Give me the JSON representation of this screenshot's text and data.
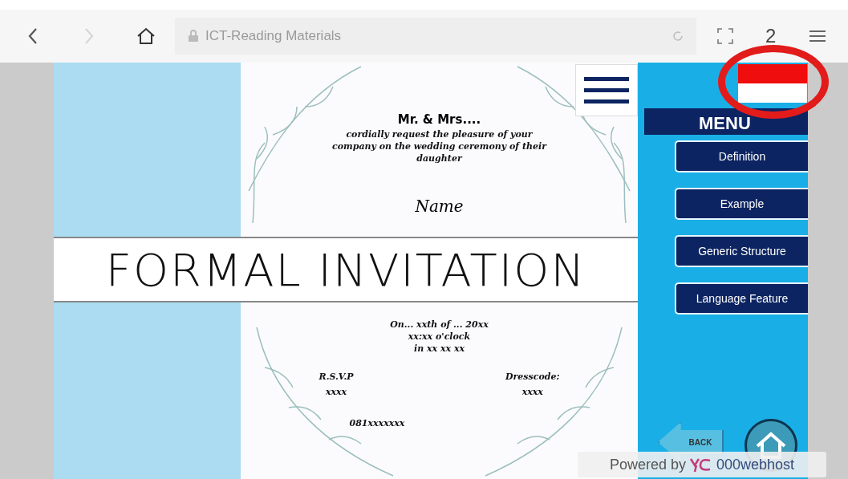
{
  "browser": {
    "back_disabled": false,
    "forward_disabled": true,
    "address": "ICT-Reading Materials",
    "tab_count": "2"
  },
  "invitation": {
    "hosts": "Mr. & Mrs....",
    "request": "cordially request the pleasure of your company on the wedding ceremony of their daughter",
    "name": "Name",
    "title": "FORMAL INVITATION",
    "date": "On... xxth of ... 20xx",
    "time": "xx:xx o'clock",
    "place": "in xx xx xx",
    "rsvp_label": "R.S.V.P",
    "rsvp_value": "xxxx",
    "dresscode_label": "Dresscode:",
    "dresscode_value": "xxxx",
    "phone": "081xxxxxxx"
  },
  "menu": {
    "title": "MENU",
    "items": [
      "Definition",
      "Example",
      "Generic Structure",
      "Language Feature"
    ]
  },
  "back_button": "BACK",
  "footer": {
    "powered_by": "Powered by",
    "host": "000webhost"
  }
}
